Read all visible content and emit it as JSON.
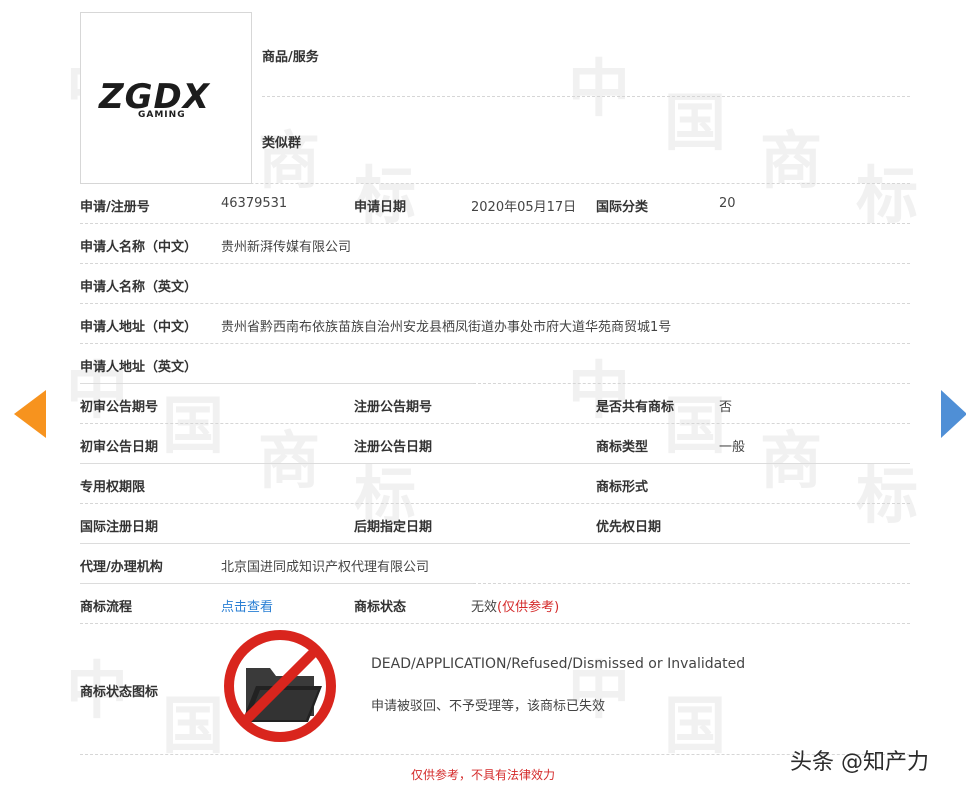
{
  "logo": {
    "main_text": "ZGDX",
    "sub_text": "GAMING"
  },
  "goods_services": {
    "label": "商品/服务",
    "value": ""
  },
  "similar_group": {
    "label": "类似群",
    "value": ""
  },
  "registration_no": {
    "label": "申请/注册号",
    "value": "46379531"
  },
  "application_date": {
    "label": "申请日期",
    "value": "2020年05月17日"
  },
  "intl_class": {
    "label": "国际分类",
    "value": "20"
  },
  "applicant_name_cn": {
    "label": "申请人名称（中文）",
    "value": "贵州新湃传媒有限公司"
  },
  "applicant_name_en": {
    "label": "申请人名称（英文）",
    "value": ""
  },
  "applicant_address_cn": {
    "label": "申请人地址（中文）",
    "value": "贵州省黔西南布依族苗族自治州安龙县栖凤街道办事处市府大道华苑商贸城1号"
  },
  "applicant_address_en": {
    "label": "申请人地址（英文）",
    "value": ""
  },
  "prelim_pub_no": {
    "label": "初审公告期号",
    "value": ""
  },
  "reg_pub_no": {
    "label": "注册公告期号",
    "value": ""
  },
  "shared_mark": {
    "label": "是否共有商标",
    "value": "否"
  },
  "prelim_pub_date": {
    "label": "初审公告日期",
    "value": ""
  },
  "reg_pub_date": {
    "label": "注册公告日期",
    "value": ""
  },
  "mark_type": {
    "label": "商标类型",
    "value": "一般"
  },
  "exclusive_period": {
    "label": "专用权期限",
    "value": ""
  },
  "mark_form": {
    "label": "商标形式",
    "value": ""
  },
  "intl_reg_date": {
    "label": "国际注册日期",
    "value": ""
  },
  "later_designation_date": {
    "label": "后期指定日期",
    "value": ""
  },
  "priority_date": {
    "label": "优先权日期",
    "value": ""
  },
  "agency": {
    "label": "代理/办理机构",
    "value": "北京国进同成知识产权代理有限公司"
  },
  "process": {
    "label": "商标流程",
    "link_text": "点击查看"
  },
  "status": {
    "label": "商标状态",
    "value": "无效",
    "note": "(仅供参考)"
  },
  "status_icon": {
    "label": "商标状态图标",
    "icon": "invalid-folder-icon",
    "english": "DEAD/APPLICATION/Refused/Dismissed or Invalidated",
    "chinese": "申请被驳回、不予受理等，该商标已失效"
  },
  "footer_note": "仅供参考，不具有法律效力",
  "credit": "头条 @知产力",
  "watermark_chars": [
    "中",
    "国",
    "商",
    "标"
  ],
  "colors": {
    "accent_link": "#2a7fd4",
    "warning_red": "#d42a2a",
    "prev_arrow": "#f7931e",
    "next_arrow": "#4f8fd6"
  }
}
